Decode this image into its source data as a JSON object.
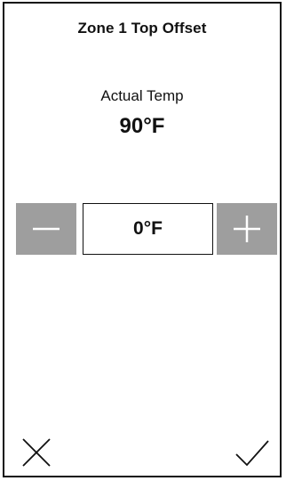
{
  "header": {
    "title": "Zone 1 Top Offset"
  },
  "actual": {
    "label": "Actual Temp",
    "value": "90°F"
  },
  "offset": {
    "value": "0°F",
    "decrement_icon": "minus-icon",
    "increment_icon": "plus-icon"
  },
  "actions": {
    "cancel_icon": "close-icon",
    "confirm_icon": "checkmark-icon"
  },
  "colors": {
    "stepper_button": "#9e9e9e",
    "text": "#111111",
    "background": "#ffffff"
  }
}
